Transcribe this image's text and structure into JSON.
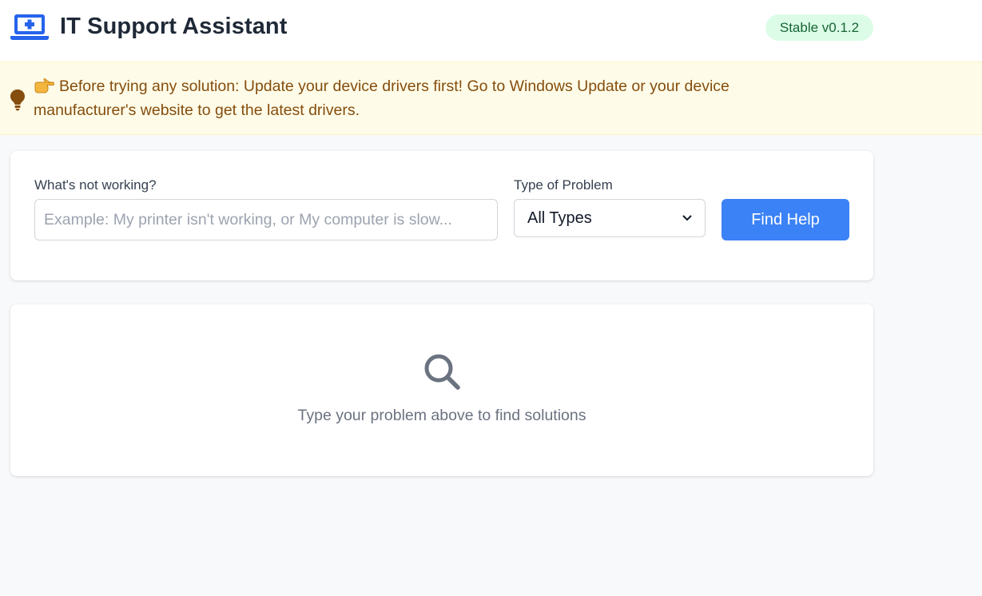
{
  "header": {
    "title": "IT Support Assistant",
    "version_badge": "Stable v0.1.2",
    "logo_icon": "laptop-medical-icon"
  },
  "notice": {
    "icon": "lightbulb-icon",
    "pointer_icon": "pointing-hand-icon",
    "text": "Before trying any solution: Update your device drivers first! Go to Windows Update or your device manufacturer's website to get the latest drivers."
  },
  "search": {
    "problem_label": "What's not working?",
    "problem_placeholder": "Example: My printer isn't working, or My computer is slow...",
    "problem_value": "",
    "type_label": "Type of Problem",
    "type_selected": "All Types",
    "button_label": "Find Help"
  },
  "results": {
    "icon": "search-icon",
    "empty_message": "Type your problem above to find solutions"
  },
  "colors": {
    "accent": "#3b82f6",
    "badge_bg": "#dcfce7",
    "badge_text": "#166534",
    "notice_bg": "#fefce8",
    "notice_text": "#854d0e"
  }
}
